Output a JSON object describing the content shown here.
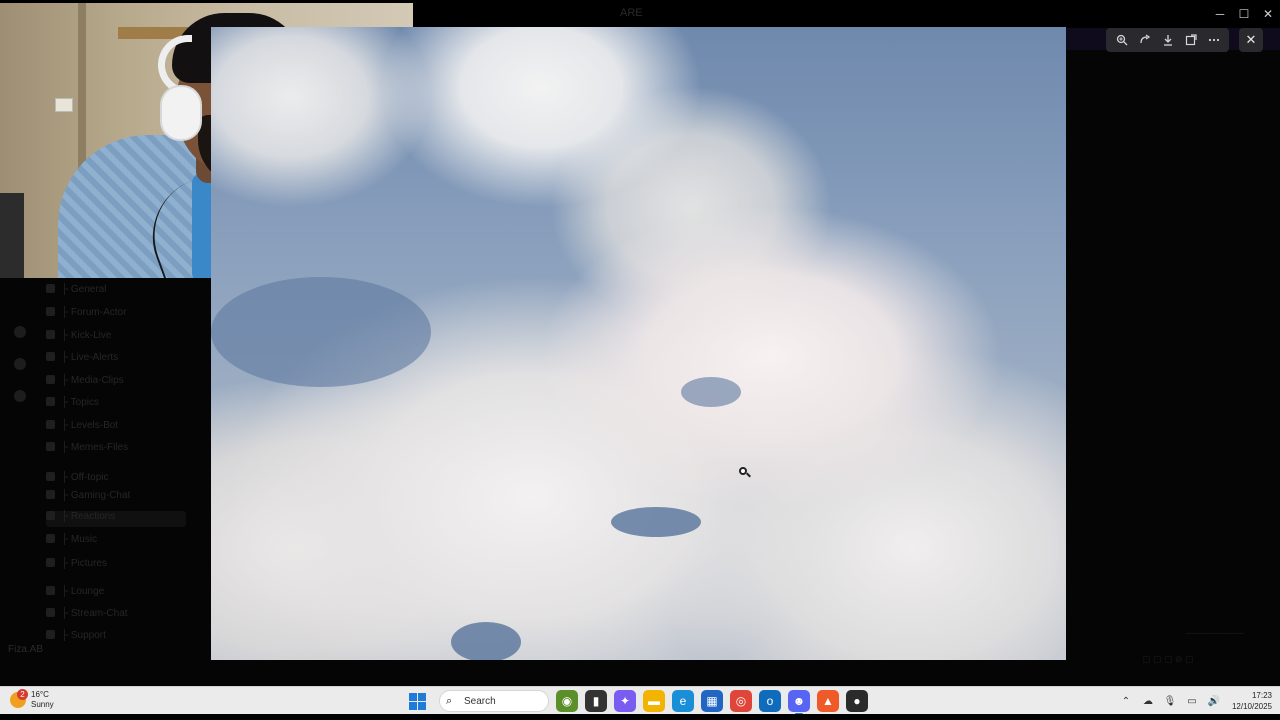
{
  "window": {
    "title": "ARE",
    "controls": {
      "minimize": "─",
      "maximize": "☐",
      "close": "✕"
    }
  },
  "sidebar": {
    "channels": [
      {
        "label": "├ General"
      },
      {
        "label": "├ Forum-Actor"
      },
      {
        "label": "├ Kick-Live"
      },
      {
        "label": "├ Live-Alerts"
      },
      {
        "label": "├ Media-Clips"
      },
      {
        "label": "├ Topics"
      },
      {
        "label": "├ Levels-Bot"
      },
      {
        "label": "├ Memes-Files"
      },
      {
        "label": "├ Off-topic"
      },
      {
        "label": "├ Gaming-Chat"
      },
      {
        "label": "├ Reactions"
      },
      {
        "label": "├ Music"
      },
      {
        "label": "├ Pictures"
      },
      {
        "label": "├ Lounge"
      },
      {
        "label": "├ Stream-Chat"
      },
      {
        "label": "├ Support"
      }
    ],
    "user": "Fiza.AB"
  },
  "viewer": {
    "toolbar": {
      "zoom_icon": "zoom-in",
      "rotate_icon": "rotate",
      "download_icon": "download",
      "open_icon": "open-external",
      "more_icon": "more"
    },
    "close_glyph": "✕"
  },
  "taskbar": {
    "weather": {
      "badge": "2",
      "temp": "16°C",
      "condition": "Sunny"
    },
    "search": {
      "placeholder": "Search"
    },
    "apps": [
      {
        "name": "widgets-icon",
        "glyph": "◉",
        "color": "#5a8f2a"
      },
      {
        "name": "task-view-icon",
        "glyph": "▮",
        "color": "#333333"
      },
      {
        "name": "copilot-icon",
        "glyph": "✦",
        "color": "#7b5cf0"
      },
      {
        "name": "file-explorer-icon",
        "glyph": "▬",
        "color": "#f2b400"
      },
      {
        "name": "edge-icon",
        "glyph": "e",
        "color": "#1a8fd8"
      },
      {
        "name": "store-icon",
        "glyph": "▦",
        "color": "#2166c2"
      },
      {
        "name": "chrome-icon",
        "glyph": "◎",
        "color": "#e0453a"
      },
      {
        "name": "outlook-icon",
        "glyph": "o",
        "color": "#0f6cbd"
      },
      {
        "name": "discord-icon",
        "glyph": "☻",
        "color": "#5865f2"
      },
      {
        "name": "brave-icon",
        "glyph": "▲",
        "color": "#f05a28"
      },
      {
        "name": "obs-icon",
        "glyph": "●",
        "color": "#2b2b2b"
      }
    ],
    "clock": {
      "time": "17:23",
      "date": "12/10/2025"
    }
  }
}
